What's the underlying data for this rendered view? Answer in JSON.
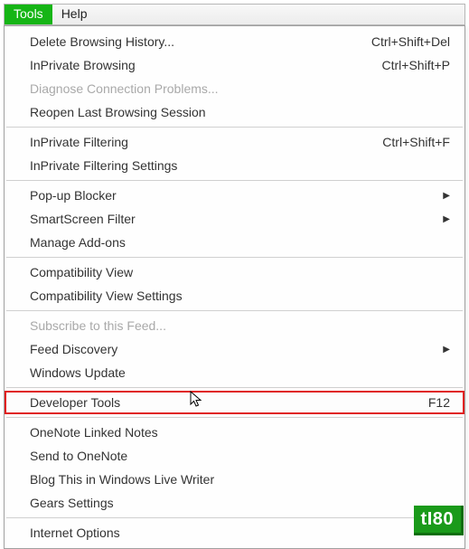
{
  "menubar": {
    "tools": "Tools",
    "help": "Help"
  },
  "menu": {
    "groups": [
      [
        {
          "label": "Delete Browsing History...",
          "shortcut": "Ctrl+Shift+Del"
        },
        {
          "label": "InPrivate Browsing",
          "shortcut": "Ctrl+Shift+P"
        },
        {
          "label": "Diagnose Connection Problems...",
          "disabled": true
        },
        {
          "label": "Reopen Last Browsing Session"
        }
      ],
      [
        {
          "label": "InPrivate Filtering",
          "shortcut": "Ctrl+Shift+F"
        },
        {
          "label": "InPrivate Filtering Settings"
        }
      ],
      [
        {
          "label": "Pop-up Blocker",
          "submenu": true
        },
        {
          "label": "SmartScreen Filter",
          "submenu": true
        },
        {
          "label": "Manage Add-ons"
        }
      ],
      [
        {
          "label": "Compatibility View"
        },
        {
          "label": "Compatibility View Settings"
        }
      ],
      [
        {
          "label": "Subscribe to this Feed...",
          "disabled": true
        },
        {
          "label": "Feed Discovery",
          "submenu": true
        },
        {
          "label": "Windows Update"
        }
      ],
      [
        {
          "label": "Developer Tools",
          "shortcut": "F12",
          "highlighted": true
        }
      ],
      [
        {
          "label": "OneNote Linked Notes"
        },
        {
          "label": "Send to OneNote"
        },
        {
          "label": "Blog This in Windows Live Writer"
        },
        {
          "label": "Gears Settings"
        }
      ],
      [
        {
          "label": "Internet Options"
        }
      ]
    ]
  },
  "badge": {
    "text": "tI80"
  }
}
